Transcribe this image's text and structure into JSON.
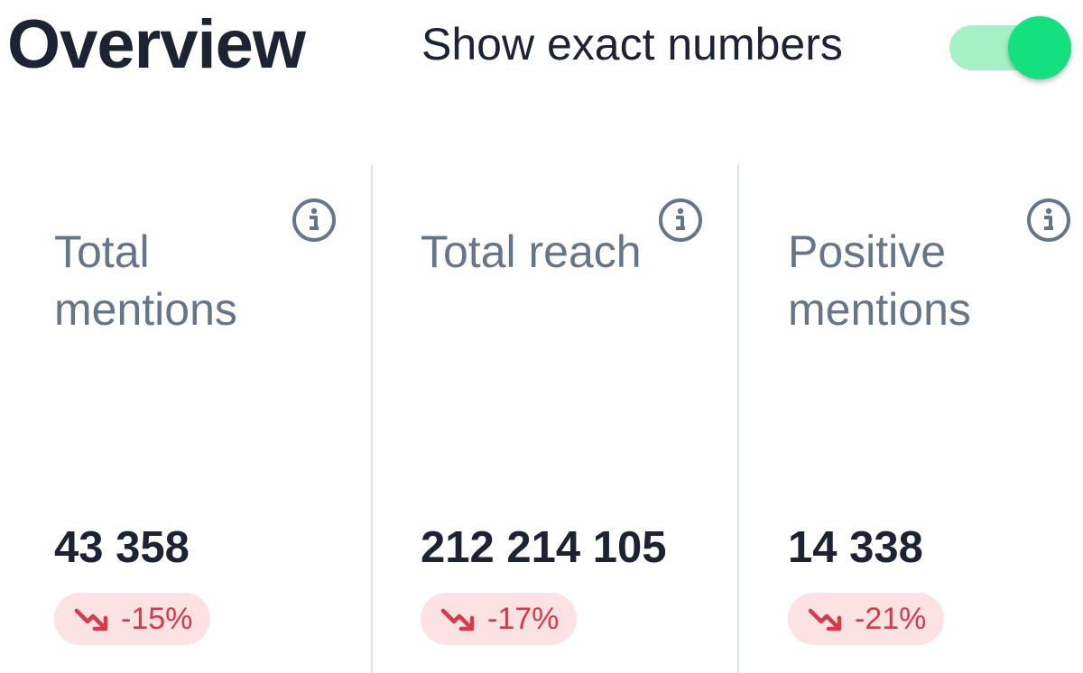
{
  "header": {
    "title": "Overview",
    "toggle_label": "Show exact numbers",
    "toggle_on": true
  },
  "metrics": [
    {
      "label": "Total mentions",
      "value": "43 358",
      "change": "-15%",
      "trend_icon": "trend-down-icon",
      "info_icon": "info-icon"
    },
    {
      "label": "Total reach",
      "value": "212 214 105",
      "change": "-17%",
      "trend_icon": "trend-down-icon",
      "info_icon": "info-icon"
    },
    {
      "label": "Positive mentions",
      "value": "14 338",
      "change": "-21%",
      "trend_icon": "trend-down-icon",
      "info_icon": "info-icon"
    }
  ],
  "colors": {
    "title": "#1c2333",
    "label": "#667689",
    "toggle_track": "#a6f0c6",
    "toggle_knob": "#13e07f",
    "badge_bg": "#fde2e4",
    "badge_text": "#d63a4b",
    "divider": "#dde1e6"
  }
}
